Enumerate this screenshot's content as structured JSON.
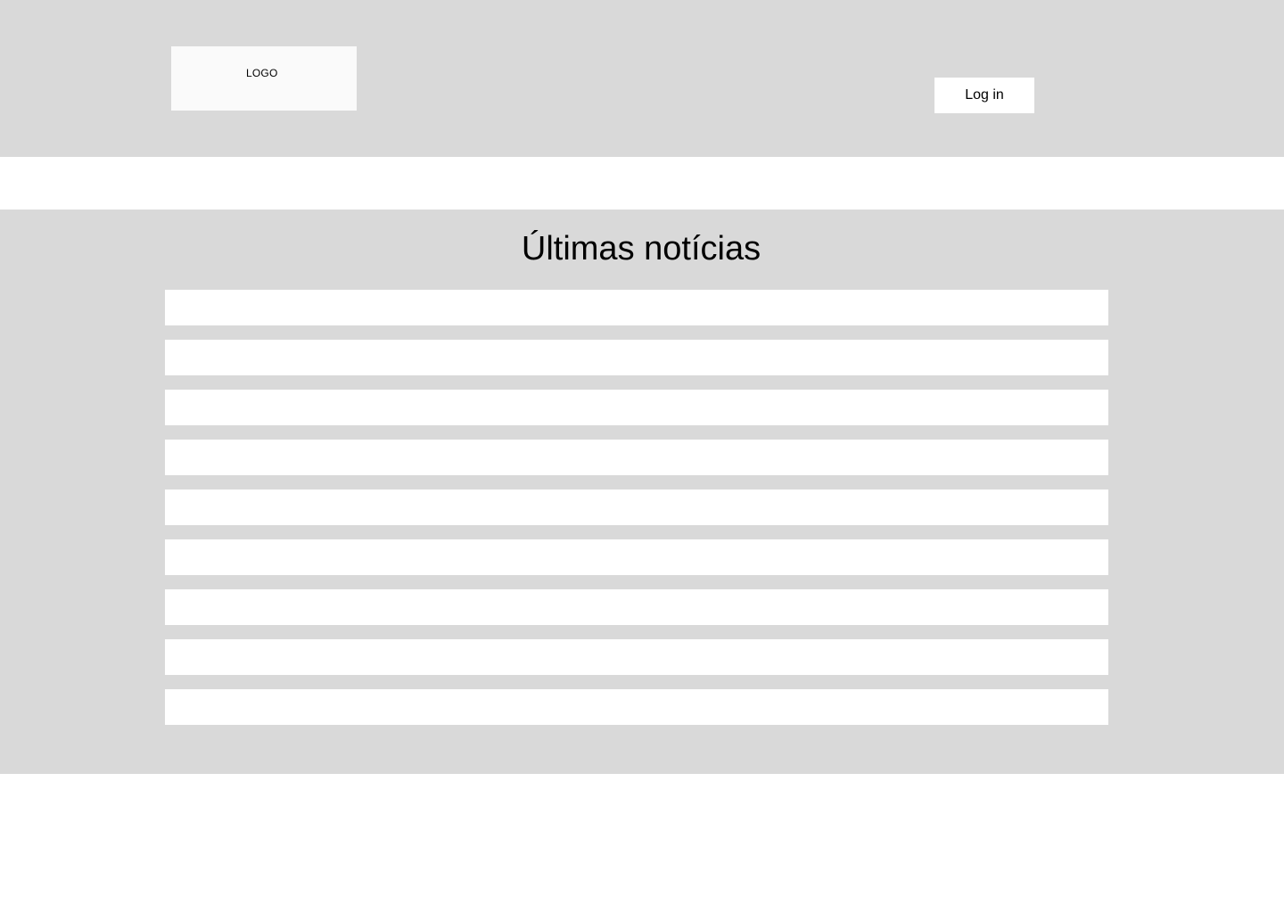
{
  "header": {
    "logo_text": "LOGO",
    "login_label": "Log in"
  },
  "news": {
    "title": "Últimas notícias",
    "items": [
      {
        "text": ""
      },
      {
        "text": ""
      },
      {
        "text": ""
      },
      {
        "text": ""
      },
      {
        "text": ""
      },
      {
        "text": ""
      },
      {
        "text": ""
      },
      {
        "text": ""
      },
      {
        "text": ""
      }
    ]
  },
  "colors": {
    "panel_background": "#d9d9d9",
    "logo_background": "#fafafa",
    "item_background": "#ffffff",
    "text": "#000000"
  }
}
